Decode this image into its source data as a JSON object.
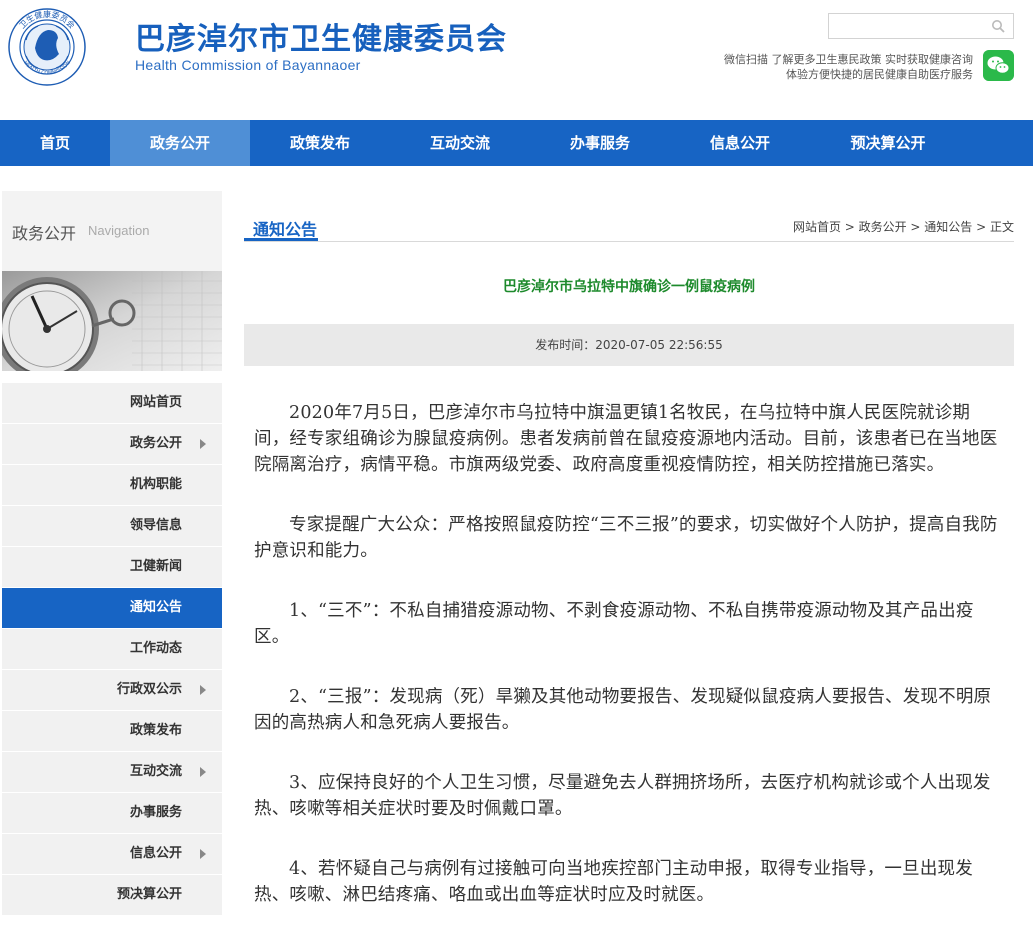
{
  "header": {
    "title_cn": "巴彦淖尔市卫生健康委员会",
    "title_en": "Health Commission of Bayannaoer",
    "emblem_text": "卫生健康委员会",
    "emblem_text_en": "HEALTH COMMISSION",
    "search_placeholder": "",
    "wechat_line1": "微信扫描 了解更多卫生惠民政策 实时获取健康咨询",
    "wechat_line2": "体验方便快捷的居民健康自助医疗服务"
  },
  "nav": {
    "items": [
      {
        "label": "首页"
      },
      {
        "label": "政务公开"
      },
      {
        "label": "政策发布"
      },
      {
        "label": "互动交流"
      },
      {
        "label": "办事服务"
      },
      {
        "label": "信息公开"
      },
      {
        "label": "预决算公开"
      }
    ],
    "active_index": 1
  },
  "sidebar": {
    "head_cn": "政务公开",
    "head_en": "Navigation",
    "items": [
      {
        "label": "网站首页",
        "has_arrow": false
      },
      {
        "label": "政务公开",
        "has_arrow": true
      },
      {
        "label": "机构职能",
        "has_arrow": false
      },
      {
        "label": "领导信息",
        "has_arrow": false
      },
      {
        "label": "卫健新闻",
        "has_arrow": false
      },
      {
        "label": "通知公告",
        "has_arrow": false
      },
      {
        "label": "工作动态",
        "has_arrow": false
      },
      {
        "label": "行政双公示",
        "has_arrow": true
      },
      {
        "label": "政策发布",
        "has_arrow": false
      },
      {
        "label": "互动交流",
        "has_arrow": true
      },
      {
        "label": "办事服务",
        "has_arrow": false
      },
      {
        "label": "信息公开",
        "has_arrow": true
      },
      {
        "label": "预决算公开",
        "has_arrow": false
      }
    ],
    "active_index": 5
  },
  "main": {
    "section_title": "通知公告",
    "breadcrumb": "网站首页 > 政务公开 > 通知公告 > 正文",
    "article_title": "巴彦淖尔市乌拉特中旗确诊一例鼠疫病例",
    "publish_time": "发布时间：2020-07-05 22:56:55",
    "paragraphs": [
      "2020年7月5日，巴彦淖尔市乌拉特中旗温更镇1名牧民，在乌拉特中旗人民医院就诊期间，经专家组确诊为腺鼠疫病例。患者发病前曾在鼠疫疫源地内活动。目前，该患者已在当地医院隔离治疗，病情平稳。市旗两级党委、政府高度重视疫情防控，相关防控措施已落实。",
      "专家提醒广大公众：严格按照鼠疫防控“三不三报”的要求，切实做好个人防护，提高自我防护意识和能力。",
      "1、“三不”：不私自捕猎疫源动物、不剥食疫源动物、不私自携带疫源动物及其产品出疫区。",
      "2、“三报”：发现病（死）旱獭及其他动物要报告、发现疑似鼠疫病人要报告、发现不明原因的高热病人和急死病人要报告。",
      "3、应保持良好的个人卫生习惯，尽量避免去人群拥挤场所，去医疗机构就诊或个人出现发热、咳嗽等相关症状时要及时佩戴口罩。",
      "4、若怀疑自己与病例有过接触可向当地疾控部门主动申报，取得专业指导，一旦出现发热、咳嗽、淋巴结疼痛、咯血或出血等症状时应及时就医。"
    ]
  },
  "colors": {
    "brand_blue": "#1764c4",
    "nav_active": "#4f8fd6",
    "title_green": "#1d8a2c",
    "wechat_green": "#2bb94a"
  }
}
